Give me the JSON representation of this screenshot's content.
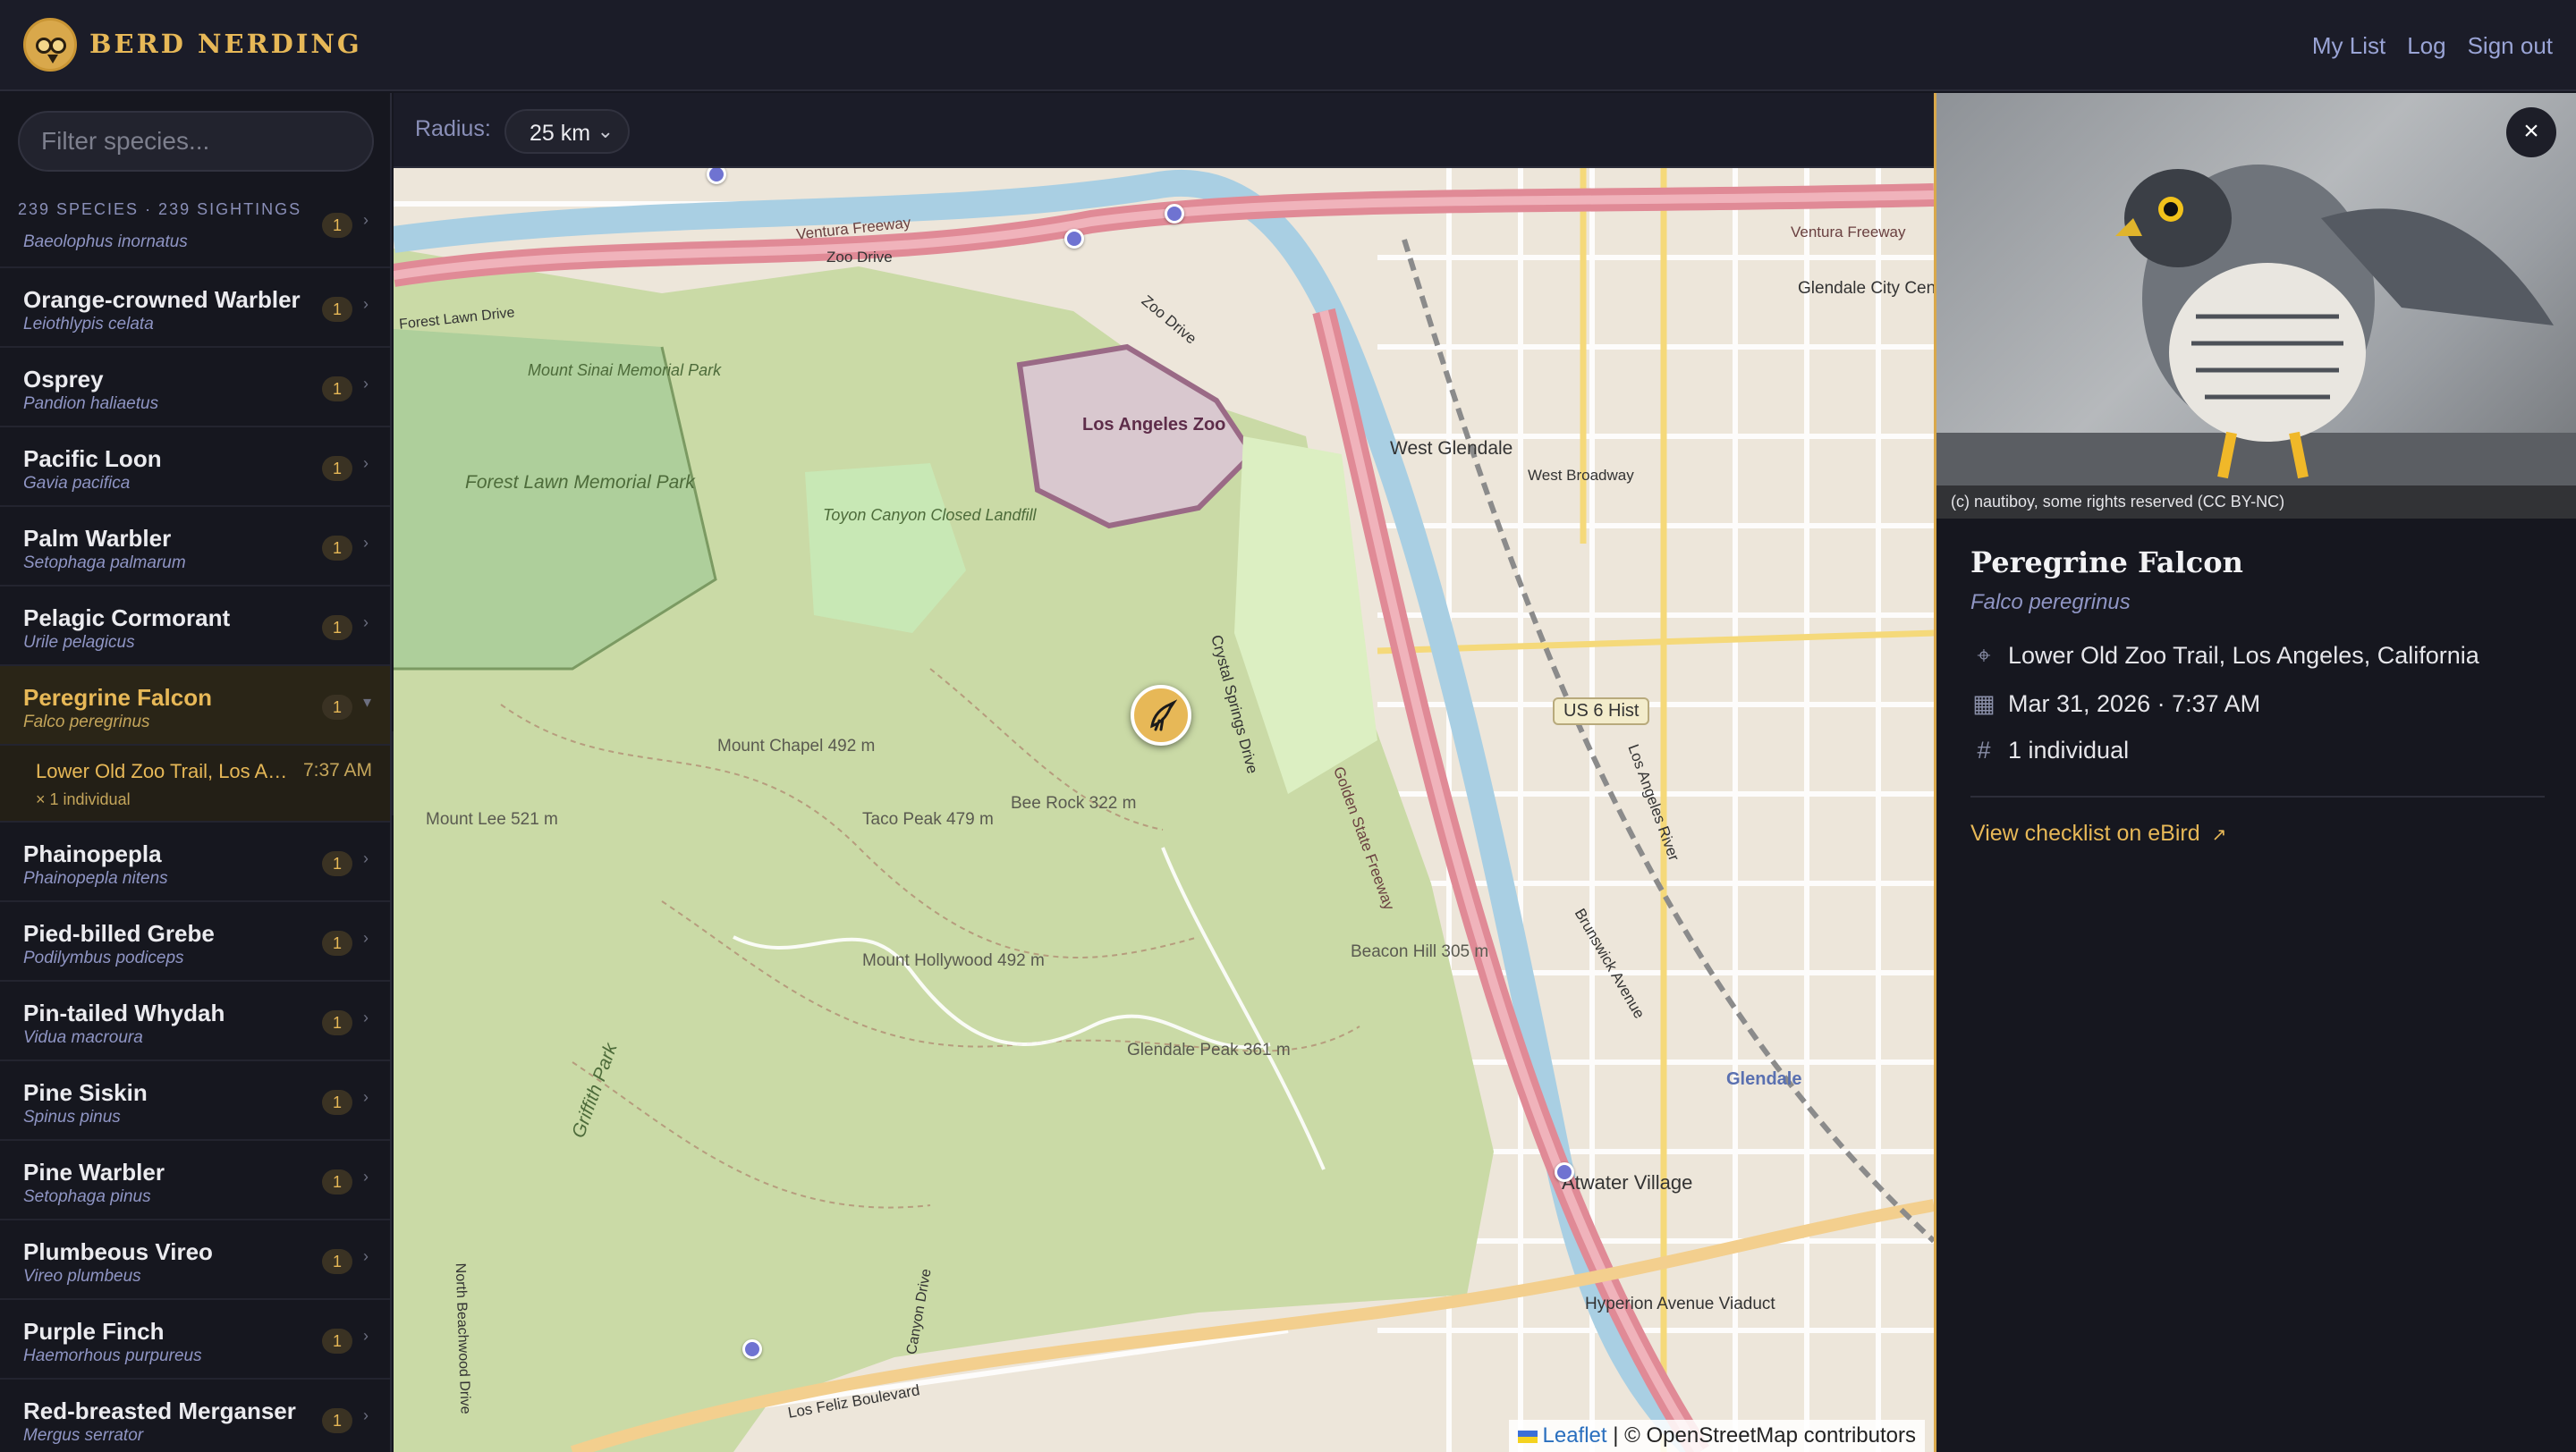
{
  "header": {
    "brand": "BERD NERDING",
    "nav": [
      "My List",
      "Log",
      "Sign out"
    ]
  },
  "sidebar": {
    "filter_placeholder": "Filter species...",
    "counts": "239 SPECIES · 239 SIGHTINGS",
    "items": [
      {
        "common": "",
        "sci": "Baeolophus inornatus",
        "count": "1"
      },
      {
        "common": "Orange-crowned Warbler",
        "sci": "Leiothlypis celata",
        "count": "1"
      },
      {
        "common": "Osprey",
        "sci": "Pandion haliaetus",
        "count": "1"
      },
      {
        "common": "Pacific Loon",
        "sci": "Gavia pacifica",
        "count": "1"
      },
      {
        "common": "Palm Warbler",
        "sci": "Setophaga palmarum",
        "count": "1"
      },
      {
        "common": "Pelagic Cormorant",
        "sci": "Urile pelagicus",
        "count": "1"
      },
      {
        "common": "Peregrine Falcon",
        "sci": "Falco peregrinus",
        "count": "1"
      },
      {
        "common": "Phainopepla",
        "sci": "Phainopepla nitens",
        "count": "1"
      },
      {
        "common": "Pied-billed Grebe",
        "sci": "Podilymbus podiceps",
        "count": "1"
      },
      {
        "common": "Pin-tailed Whydah",
        "sci": "Vidua macroura",
        "count": "1"
      },
      {
        "common": "Pine Siskin",
        "sci": "Spinus pinus",
        "count": "1"
      },
      {
        "common": "Pine Warbler",
        "sci": "Setophaga pinus",
        "count": "1"
      },
      {
        "common": "Plumbeous Vireo",
        "sci": "Vireo plumbeus",
        "count": "1"
      },
      {
        "common": "Purple Finch",
        "sci": "Haemorhous purpureus",
        "count": "1"
      },
      {
        "common": "Red-breasted Merganser",
        "sci": "Mergus serrator",
        "count": "1"
      }
    ],
    "active_sighting": {
      "location": "Lower Old Zoo Trail, Los Angeles, California",
      "time": "7:37 AM",
      "individuals": "× 1 individual"
    }
  },
  "toolbar": {
    "radius_label": "Radius:",
    "radius_value": "25 km"
  },
  "map": {
    "labels": {
      "la_zoo": "Los Angeles Zoo",
      "forest_lawn": "Forest Lawn Memorial Park",
      "mount_sinai": "Mount Sinai Memorial Park",
      "toyon": "Toyon Canyon Closed Landfill",
      "west_glendale": "West Glendale",
      "west_broadway": "West Broadway",
      "glendale_city_center": "Glendale City Center",
      "mount_chapel": "Mount Chapel 492 m",
      "mount_lee": "Mount Lee 521 m",
      "taco_peak": "Taco Peak 479 m",
      "bee_rock": "Bee Rock 322 m",
      "mount_hollywood": "Mount Hollywood 492 m",
      "glendale_peak": "Glendale Peak 361 m",
      "beacon_hill": "Beacon Hill 305 m",
      "atwater": "Atwater Village",
      "glendale": "Glendale",
      "hyperion": "Hyperion Avenue Viaduct",
      "griffith_park": "Griffith Park",
      "los_feliz": "Los Feliz Boulevard",
      "ventura_fwy": "Ventura Freeway",
      "ventura_fwy_e": "Ventura Freeway",
      "zoo_drive": "Zoo Drive",
      "zoo_drive2": "Zoo Drive",
      "crystal_springs": "Crystal Springs Drive",
      "golden_state": "Golden State Freeway",
      "brunswick": "Brunswick Avenue",
      "canyon_drive": "Canyon Drive",
      "north_beachwood": "North Beachwood Drive",
      "forest_lawn_drive": "Forest Lawn Drive",
      "la_river": "Los Angeles River",
      "us6": "US 6 Hist"
    },
    "attribution_leaflet": "Leaflet",
    "attribution_osm": "| © OpenStreetMap contributors"
  },
  "detail": {
    "photo_credit": "(c) nautiboy, some rights reserved (CC BY-NC)",
    "common": "Peregrine Falcon",
    "sci": "Falco peregrinus",
    "location": "Lower Old Zoo Trail, Los Angeles, California",
    "datetime": "Mar 31, 2026 · 7:37 AM",
    "count": "1 individual",
    "ebird_link": "View checklist on eBird"
  },
  "colors": {
    "accent": "#e7b857",
    "marker": "#6f73d1",
    "park": "#c8d9a8",
    "highway": "#e08a96"
  }
}
